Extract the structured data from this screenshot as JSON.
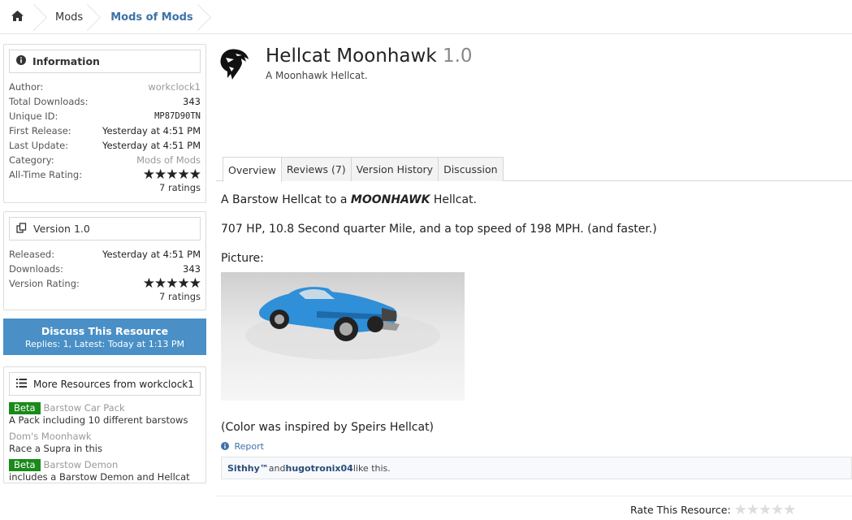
{
  "breadcrumb": {
    "home_icon": "home-icon",
    "items": [
      "Mods",
      "Mods of Mods"
    ]
  },
  "information": {
    "heading": "Information",
    "rows": [
      {
        "k": "Author:",
        "v": "workclock1"
      },
      {
        "k": "Total Downloads:",
        "v": "343"
      },
      {
        "k": "Unique ID:",
        "v": "MP87D90TN"
      },
      {
        "k": "First Release:",
        "v": "Yesterday at 4:51 PM"
      },
      {
        "k": "Last Update:",
        "v": "Yesterday at 4:51 PM"
      },
      {
        "k": "Category:",
        "v": "Mods of Mods"
      },
      {
        "k": "All-Time Rating:",
        "v": "★★★★★"
      }
    ],
    "ratings": "7 ratings"
  },
  "version": {
    "heading": "Version 1.0",
    "rows": [
      {
        "k": "Released:",
        "v": "Yesterday at 4:51 PM"
      },
      {
        "k": "Downloads:",
        "v": "343"
      },
      {
        "k": "Version Rating:",
        "v": "★★★★★"
      }
    ],
    "ratings": "7 ratings"
  },
  "discuss": {
    "title": "Discuss This Resource",
    "subtitle": "Replies: 1, Latest: Today at 1:13 PM"
  },
  "more": {
    "heading": "More Resources from workclock1",
    "items": [
      {
        "badge": "Beta",
        "title": "Barstow Car Pack",
        "desc": "A Pack including 10 different barstows"
      },
      {
        "badge": "",
        "title": "Dom's Moonhawk",
        "desc": "Race a Supra in this"
      },
      {
        "badge": "Beta",
        "title": "Barstow Demon",
        "desc": "includes a Barstow Demon and Hellcat"
      }
    ]
  },
  "resource": {
    "title": "Hellcat Moonhawk",
    "version": "1.0",
    "tagline": "A Moonhawk Hellcat.",
    "tabs": [
      "Overview",
      "Reviews (7)",
      "Version History",
      "Discussion"
    ],
    "line1_pre": "A Barstow Hellcat to a ",
    "line1_bold": "MOONHAWK",
    "line1_post": " Hellcat.",
    "line2": "707 HP, 10.8 Second quarter Mile, and a top speed of 198 MPH. (and faster.)",
    "picture_label": "Picture:",
    "line3": "(Color was inspired by Speirs Hellcat)",
    "report": "Report",
    "likes_user1": "Sithhy™",
    "likes_and": " and ",
    "likes_user2": "hugotronix04",
    "likes_suffix": " like this.",
    "rate_label": "Rate This Resource:",
    "rate_stars": "★★★★★"
  },
  "colors": {
    "accent": "#4a90c6",
    "link": "#3d72a8",
    "star": "#f0c000",
    "beta": "#1a8a1a",
    "car": "#2f8fd8"
  }
}
